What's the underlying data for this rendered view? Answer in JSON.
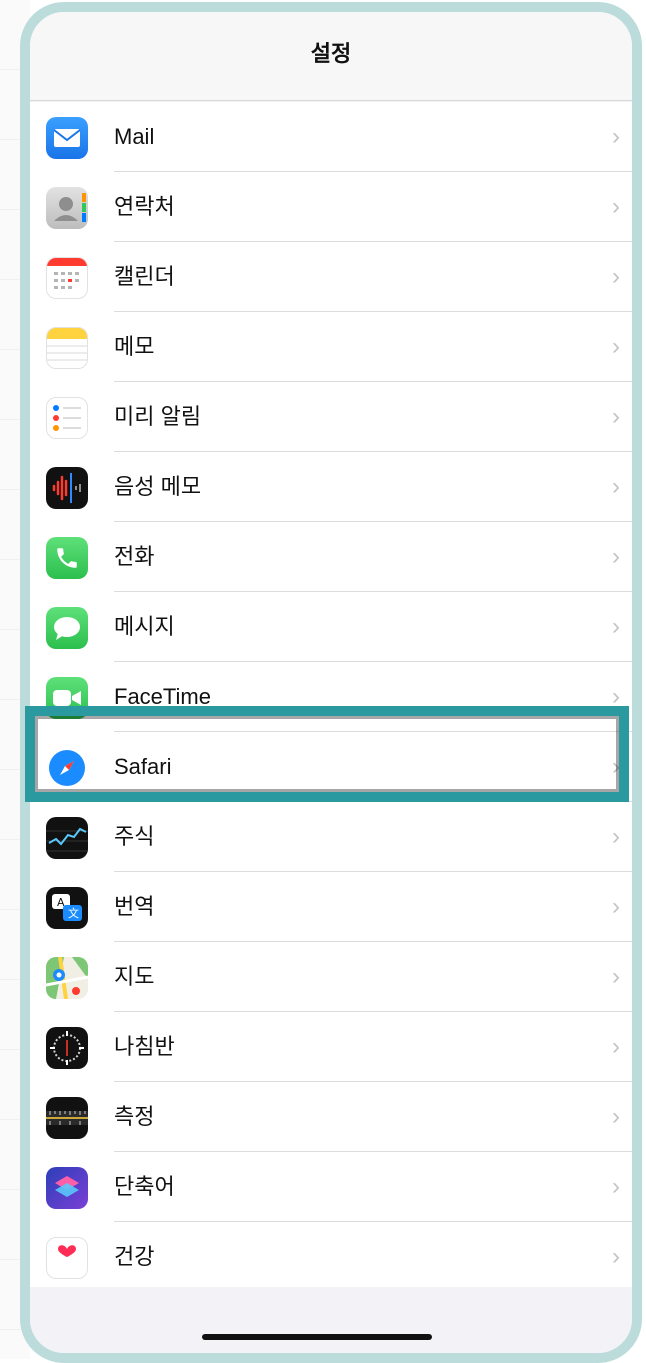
{
  "nav": {
    "title": "설정"
  },
  "rows": [
    {
      "label": "Mail",
      "icon": "mail-icon",
      "color": "#1b8ef8"
    },
    {
      "label": "연락처",
      "icon": "contacts-icon",
      "color": "#c9c9c9"
    },
    {
      "label": "캘린더",
      "icon": "calendar-icon",
      "color": "#ffffff"
    },
    {
      "label": "메모",
      "icon": "notes-icon",
      "color": "#ffd23f"
    },
    {
      "label": "미리 알림",
      "icon": "reminders-icon",
      "color": "#ffffff"
    },
    {
      "label": "음성 메모",
      "icon": "voice-memos-icon",
      "color": "#111111"
    },
    {
      "label": "전화",
      "icon": "phone-icon",
      "color": "#34c759"
    },
    {
      "label": "메시지",
      "icon": "messages-icon",
      "color": "#34c759"
    },
    {
      "label": "FaceTime",
      "icon": "facetime-icon",
      "color": "#34c759"
    },
    {
      "label": "Safari",
      "icon": "safari-icon",
      "color": "#1a8cff"
    },
    {
      "label": "주식",
      "icon": "stocks-icon",
      "color": "#111111"
    },
    {
      "label": "번역",
      "icon": "translate-icon",
      "color": "#111111"
    },
    {
      "label": "지도",
      "icon": "maps-icon",
      "color": "#6cc16c"
    },
    {
      "label": "나침반",
      "icon": "compass-icon",
      "color": "#111111"
    },
    {
      "label": "측정",
      "icon": "measure-icon",
      "color": "#111111"
    },
    {
      "label": "단축어",
      "icon": "shortcuts-icon",
      "color": "#5b3fd0"
    },
    {
      "label": "건강",
      "icon": "health-icon",
      "color": "#ffffff"
    }
  ],
  "highlight": {
    "target": "Safari",
    "color": "#2b9aa0"
  }
}
